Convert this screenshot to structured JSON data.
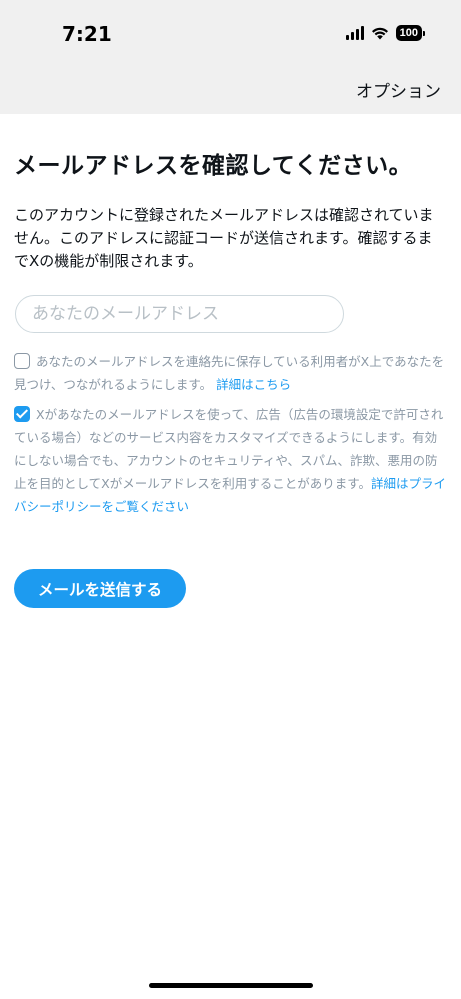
{
  "status_bar": {
    "time": "7:21",
    "battery": "100"
  },
  "header": {
    "options_label": "オプション"
  },
  "main": {
    "title": "メールアドレスを確認してください。",
    "description": "このアカウントに登録されたメールアドレスは確認されていません。このアドレスに認証コードが送信されます。確認するまでXの機能が制限されます。",
    "email": {
      "placeholder": "あなたのメールアドレス",
      "value": ""
    },
    "consents": [
      {
        "checked": false,
        "text": "あなたのメールアドレスを連絡先に保存している利用者がX上であなたを見つけ、つながれるようにします。",
        "link": "詳細はこちら"
      },
      {
        "checked": true,
        "text": "Xがあなたのメールアドレスを使って、広告（広告の環境設定で許可されている場合）などのサービス内容をカスタマイズできるようにします。有効にしない場合でも、アカウントのセキュリティや、スパム、詐欺、悪用の防止を目的としてXがメールアドレスを利用することがあります。",
        "link": "詳細はプライバシーポリシーをご覧ください"
      }
    ],
    "send_button_label": "メールを送信する"
  },
  "colors": {
    "accent": "#1d9bf0",
    "muted_text": "#8b98a5",
    "header_bg": "#f0f0f0"
  },
  "icons": [
    "signal-icon",
    "wifi-icon",
    "battery-icon",
    "checkbox-icon",
    "checkmark-icon"
  ]
}
